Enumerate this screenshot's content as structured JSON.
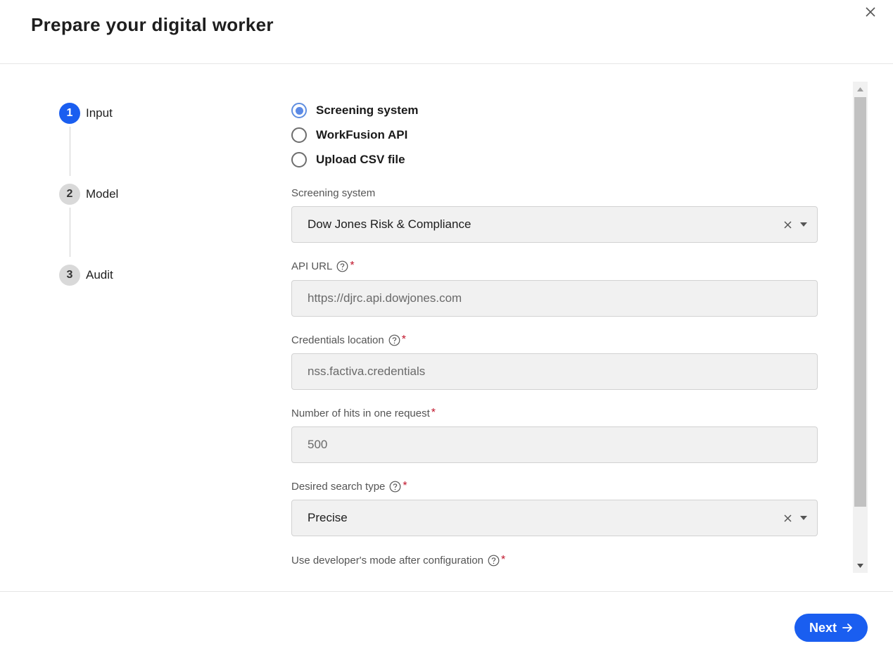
{
  "dialog": {
    "title": "Prepare your digital worker"
  },
  "steps": [
    {
      "number": "1",
      "label": "Input",
      "active": true
    },
    {
      "number": "2",
      "label": "Model",
      "active": false
    },
    {
      "number": "3",
      "label": "Audit",
      "active": false
    }
  ],
  "input_source": {
    "options": [
      "Screening system",
      "WorkFusion API",
      "Upload CSV file"
    ],
    "selected": "Screening system"
  },
  "form": {
    "screening_system": {
      "label": "Screening system",
      "value": "Dow Jones Risk & Compliance"
    },
    "api_url": {
      "label": "API URL",
      "value": "https://djrc.api.dowjones.com",
      "required_mark": "*"
    },
    "credentials_location": {
      "label": "Credentials location",
      "value": "nss.factiva.credentials",
      "required_mark": "*"
    },
    "hits_per_request": {
      "label": "Number of hits in one request",
      "value": "500",
      "required_mark": "*"
    },
    "search_type": {
      "label": "Desired search type",
      "value": "Precise",
      "required_mark": "*"
    },
    "developer_mode": {
      "label": "Use developer's mode after configuration",
      "required_mark": "*"
    }
  },
  "footer": {
    "next_label": "Next"
  },
  "colors": {
    "primary": "#1a5ef0",
    "required": "#c0152b",
    "field_bg": "#f1f1f1"
  }
}
